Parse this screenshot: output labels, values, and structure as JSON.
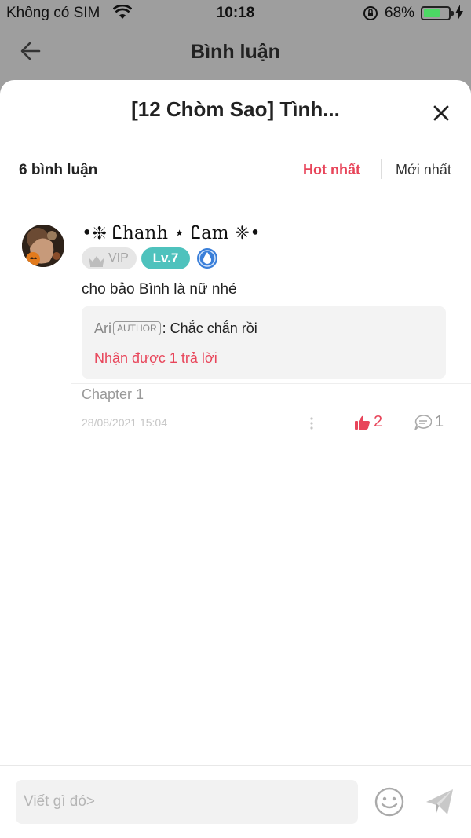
{
  "status_bar": {
    "carrier": "Không có SIM",
    "time": "10:18",
    "battery_pct": "68%",
    "battery_level": 0.68
  },
  "background_header": {
    "title": "Bình luận"
  },
  "sheet": {
    "title": "[12 Chòm Sao] Tình...",
    "comment_count": "6 bình luận",
    "sort_options": [
      "Hot nhất",
      "Mới nhất"
    ],
    "selected_sort": "Hot nhất"
  },
  "comments": [
    {
      "username": "•❈ Ꮭhanh ⋆ Ꮭam ❈•",
      "vip_label": "VIP",
      "level_label": "Lv.7",
      "content": "cho bảo Bình là nữ nhé",
      "reply": {
        "name": "Ari",
        "author_tag": "AUTHOR",
        "text": ": Chắc chắn rồi",
        "more_label": "Nhận được 1 trả lời"
      },
      "chapter": "Chapter 1",
      "timestamp": "28/08/2021 15:04",
      "likes": "2",
      "replies": "1"
    }
  ],
  "composer": {
    "placeholder": "Viết gì đó>"
  },
  "colors": {
    "accent": "#e8455a",
    "level_badge": "#4ec2bd",
    "battery": "#4cd964"
  }
}
